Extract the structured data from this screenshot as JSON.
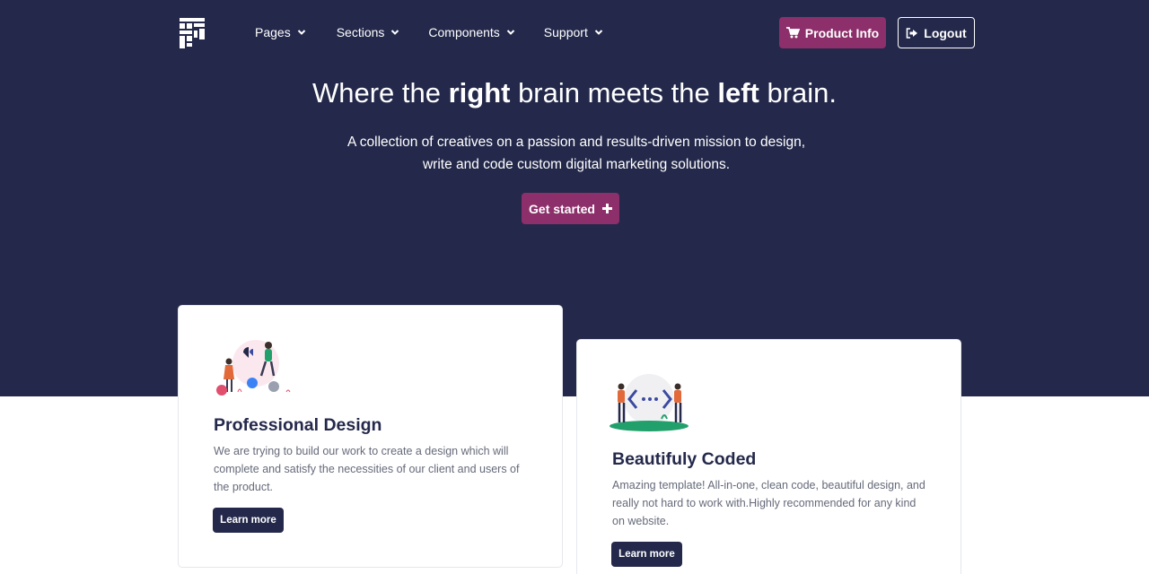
{
  "nav": {
    "items": [
      {
        "label": "Pages"
      },
      {
        "label": "Sections"
      },
      {
        "label": "Components"
      },
      {
        "label": "Support"
      }
    ],
    "product_label": "Product Info",
    "logout_label": "Logout"
  },
  "hero": {
    "headline_part1": "Where the ",
    "headline_bold1": "right",
    "headline_part2": " brain meets the ",
    "headline_bold2": "left",
    "headline_part3": " brain.",
    "subline": "A collection of creatives on a passion and results-driven mission to design, write and code custom digital marketing solutions.",
    "cta_label": "Get started"
  },
  "cards": [
    {
      "title": "Professional Design",
      "text": "We are trying to build our work to create a design which will complete and satisfy the necessities of our client and users of the product.",
      "button": "Learn more"
    },
    {
      "title": "Beautifuly Coded",
      "text": "Amazing template! All-in-one, clean code, beautiful design, and really not hard to work with.Highly recommended for any kind on website.",
      "button": "Learn more"
    }
  ],
  "icons": [
    "logo-icon",
    "chevron-down-icon",
    "cart-icon",
    "logout-icon",
    "plus-icon"
  ],
  "colors": {
    "navy": "#24294b",
    "accent": "#8c2f6a",
    "white": "#ffffff"
  }
}
